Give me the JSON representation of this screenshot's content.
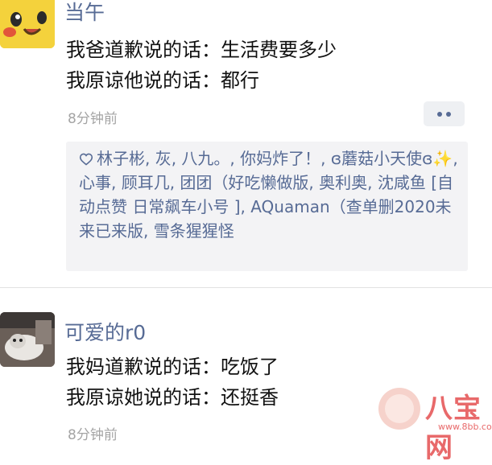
{
  "post1": {
    "nickname": "当午",
    "line1": "我爸道歉说的话：生活费要多少",
    "line2": "我原谅他说的话：都行",
    "time": "8分钟前",
    "likes_icon": "heart-outline-icon",
    "likes": "林子彬, 灰, 八九。, 你妈炸了！, ɞ蘑菇小天使ɞ✨, 心事, 顾耳几, 团团（好吃懒做版, 奥利奥, 沈咸鱼 [自动点赞 日常飙车小号 ], AQuaman（查单删2020未来已来版, 雪条猩猩怪"
  },
  "post2": {
    "nickname": "可爱的r0",
    "line1": "我妈道歉说的话：吃饭了",
    "line2": "我原谅她说的话：还挺香",
    "time": "8分钟前"
  },
  "watermark": {
    "text": "八宝网",
    "url": "www.8bb.com"
  },
  "colors": {
    "nickname": "#576b95",
    "time": "#a4a4a4",
    "likes_bg": "#f3f3f5",
    "watermark": "#e8696a"
  }
}
